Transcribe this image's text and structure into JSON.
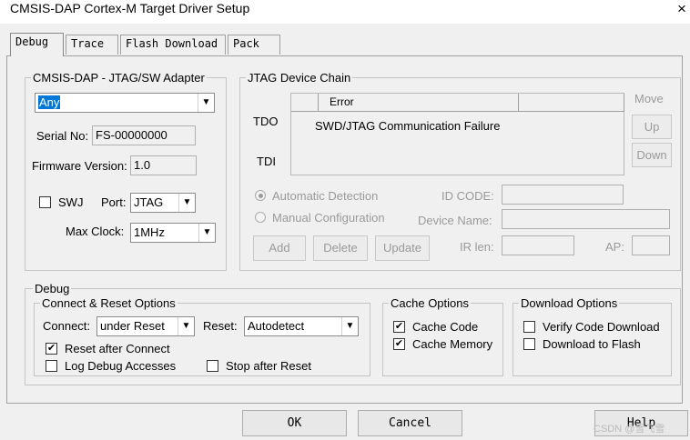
{
  "window": {
    "title": "CMSIS-DAP Cortex-M Target Driver Setup",
    "close": "×"
  },
  "tabs": [
    "Debug",
    "Trace",
    "Flash Download",
    "Pack"
  ],
  "adapter": {
    "legend": "CMSIS-DAP - JTAG/SW Adapter",
    "selected": "Any",
    "serial_label": "Serial No:",
    "serial_value": "FS-00000000",
    "firmware_label": "Firmware Version:",
    "firmware_value": "1.0",
    "swj_label": "SWJ",
    "port_label": "Port:",
    "port_value": "JTAG",
    "maxclock_label": "Max Clock:",
    "maxclock_value": "1MHz"
  },
  "chain": {
    "legend": "JTAG Device Chain",
    "tdo": "TDO",
    "tdi": "TDI",
    "col_error": "Error",
    "error_text": "SWD/JTAG Communication Failure",
    "move_label": "Move",
    "up": "Up",
    "down": "Down",
    "auto_detect": "Automatic Detection",
    "manual_config": "Manual Configuration",
    "id_code_label": "ID CODE:",
    "device_name_label": "Device Name:",
    "ir_len_label": "IR len:",
    "ap_label": "AP:",
    "add": "Add",
    "delete": "Delete",
    "update": "Update"
  },
  "debug": {
    "legend": "Debug",
    "connect_reset": {
      "legend": "Connect & Reset Options",
      "connect_label": "Connect:",
      "connect_value": "under Reset",
      "reset_label": "Reset:",
      "reset_value": "Autodetect",
      "reset_after_connect": "Reset after Connect",
      "log_debug": "Log Debug Accesses",
      "stop_after_reset": "Stop after Reset"
    },
    "cache": {
      "legend": "Cache Options",
      "code": "Cache Code",
      "memory": "Cache Memory"
    },
    "download": {
      "legend": "Download Options",
      "verify": "Verify Code Download",
      "to_flash": "Download to Flash"
    }
  },
  "footer": {
    "ok": "OK",
    "cancel": "Cancel",
    "help": "Help",
    "watermark": "CSDN @雪飞雪"
  },
  "icons": {
    "dropdown": "chevron-down-icon",
    "check": "checkmark-icon"
  }
}
